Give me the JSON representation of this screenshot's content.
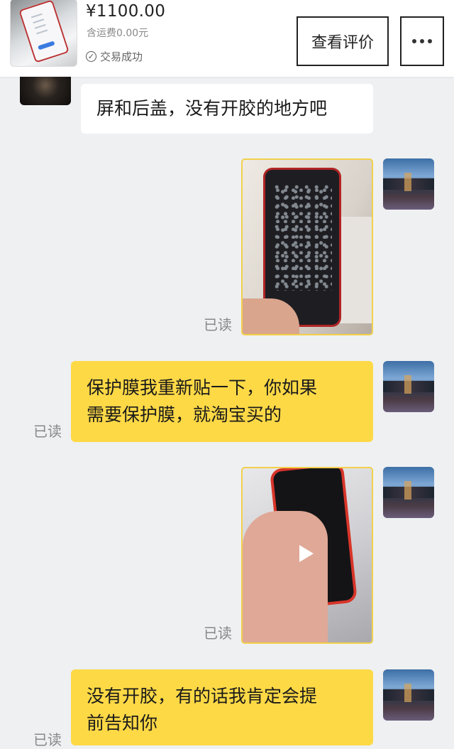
{
  "header": {
    "price": "¥1100.00",
    "shipping": "含运费0.00元",
    "status": "交易成功",
    "review_button": "查看评价"
  },
  "messages": [
    {
      "side": "left",
      "type": "text",
      "text": "屏和后盖，没有开胶的地方吧"
    },
    {
      "side": "right",
      "type": "image",
      "read": "已读"
    },
    {
      "side": "right",
      "type": "text",
      "text_line1": "保护膜我重新贴一下，你如果",
      "text_line2": "需要保护膜，就淘宝买的",
      "read": "已读"
    },
    {
      "side": "right",
      "type": "video",
      "read": "已读"
    },
    {
      "side": "right",
      "type": "text",
      "text_line1": "没有开胶，有的话我肯定会提",
      "text_line2": "前告知你",
      "read": "已读"
    }
  ],
  "icons": {
    "status": "check-circle-icon",
    "more": "more-dots-icon",
    "video": "play-icon"
  }
}
